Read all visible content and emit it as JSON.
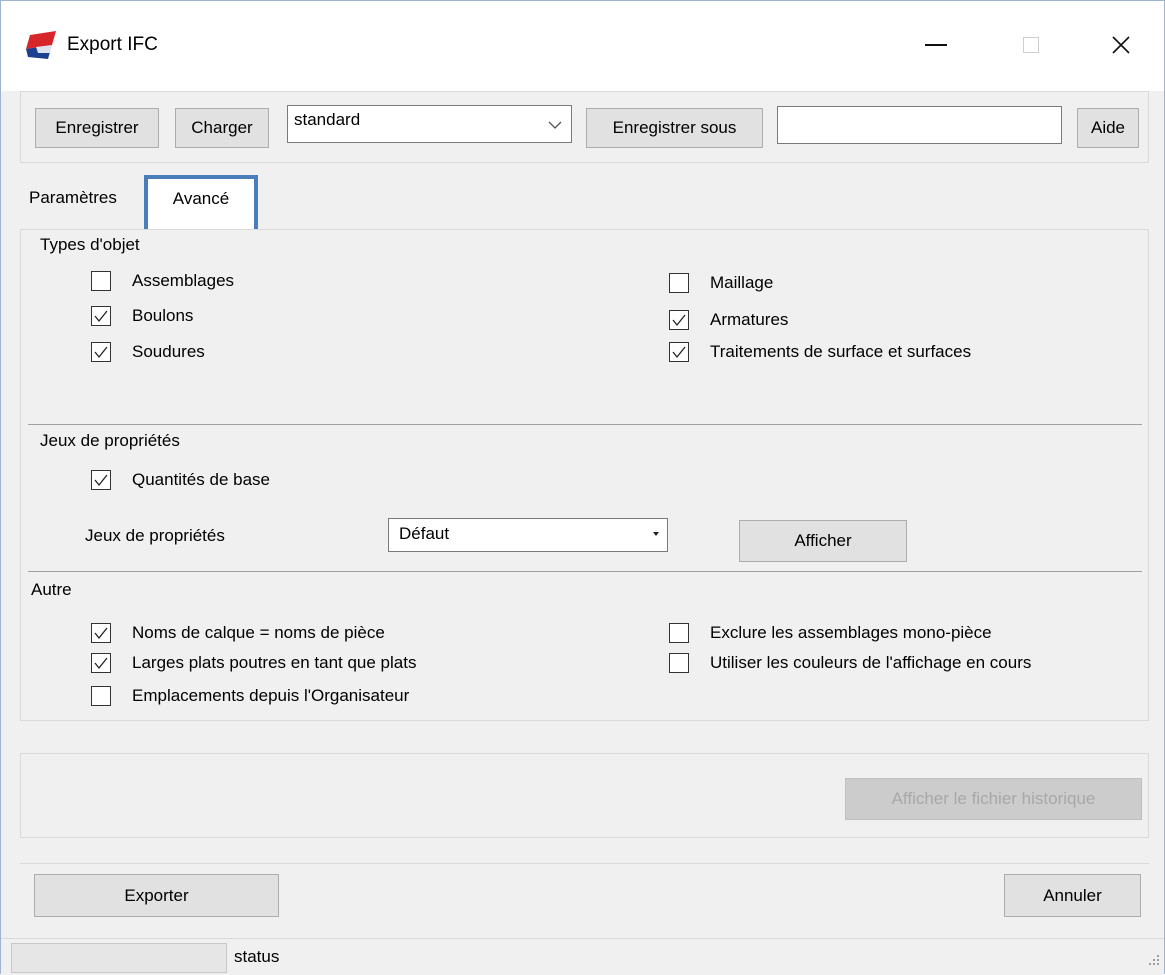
{
  "window": {
    "title": "Export IFC",
    "minimize_glyph": "—",
    "close_glyph": "✕"
  },
  "toolbar": {
    "save_label": "Enregistrer",
    "load_label": "Charger",
    "preset_value": "standard",
    "save_as_label": "Enregistrer sous",
    "save_as_value": "",
    "help_label": "Aide"
  },
  "tabs": {
    "parameters": "Paramètres",
    "advanced": "Avancé"
  },
  "object_types": {
    "title": "Types d'objet",
    "items": [
      {
        "label": "Assemblages",
        "checked": false
      },
      {
        "label": "Boulons",
        "checked": true
      },
      {
        "label": "Soudures",
        "checked": true
      },
      {
        "label": "Maillage",
        "checked": false
      },
      {
        "label": "Armatures",
        "checked": true
      },
      {
        "label": "Traitements de surface et surfaces",
        "checked": true
      }
    ]
  },
  "property_sets": {
    "title": "Jeux de propriétés",
    "base_quantities": {
      "label": "Quantités de base",
      "checked": true
    },
    "sets_label": "Jeux de propriétés",
    "sets_value": "Défaut",
    "show_label": "Afficher"
  },
  "other": {
    "title": "Autre",
    "items": [
      {
        "label": "Noms de calque = noms de pièce",
        "checked": true
      },
      {
        "label": "Larges plats poutres en tant que plats",
        "checked": true
      },
      {
        "label": "Emplacements depuis l'Organisateur",
        "checked": false
      },
      {
        "label": "Exclure les assemblages mono-pièce",
        "checked": false
      },
      {
        "label": "Utiliser les couleurs de l'affichage en cours",
        "checked": false
      }
    ]
  },
  "log": {
    "show_log_label": "Afficher le fichier historique"
  },
  "actions": {
    "export_label": "Exporter",
    "cancel_label": "Annuler"
  },
  "status": {
    "text": "status"
  },
  "colors": {
    "accent_tab_border": "#4a7ebb",
    "window_bg": "#f0f0f0"
  }
}
